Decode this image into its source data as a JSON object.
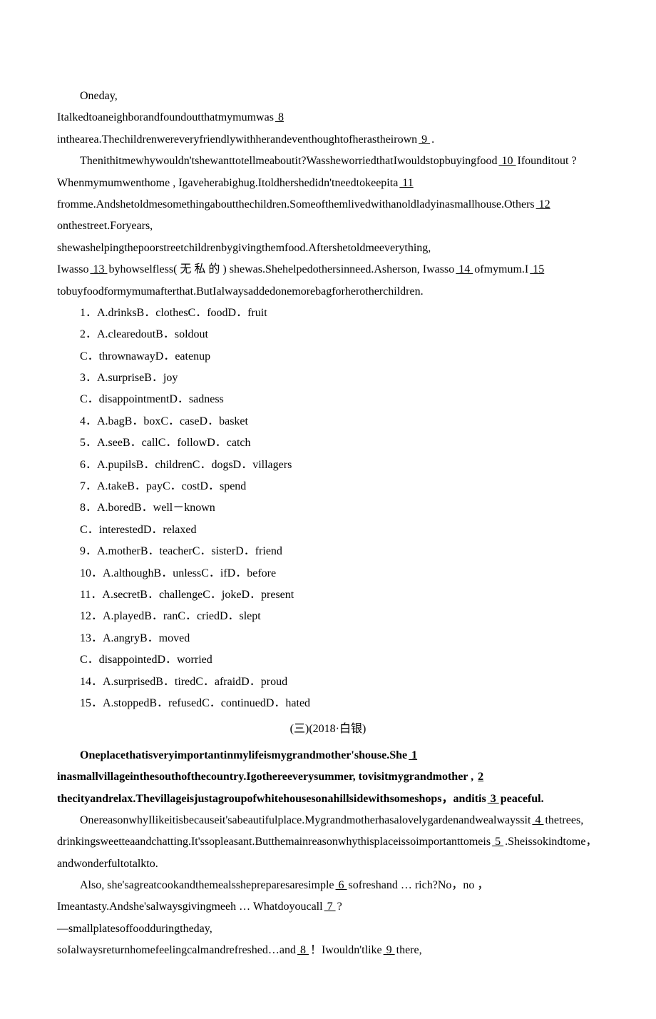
{
  "story1": {
    "p1": "Oneday,",
    "p2a": "Italkedtoaneighborandfoundoutthatmymumwas",
    "b8": "  8  ",
    "p2b": "inthearea.Thechildrenwereveryfriendlywithherandeventhoughtofherastheirown",
    "b9": "  9  ",
    "p2c": ".",
    "p3a": "Thenithitmewhywouldn'tshewanttotellmeaboutit?WassheworriedthatIwouldstopbuyingfood",
    "b10": "  10  ",
    "p3b": "Ifounditout     ?     Whenmymumwenthome   , Igaveherabighug.Itoldhershedidn'tneedtokeepita",
    "b11": "  11  ",
    "p3c": "fromme.Andshetoldmesomethingaboutthechildren.Someofthemlivedwithanoldladyinasmallhouse.Others",
    "b12": "  12  ",
    "p3d": "onthestreet.Foryears,",
    "p4": "shewashelpingthepoorstreetchildrenbygivingthemfood.Aftershetoldmeeverything,",
    "p5a": "Iwasso",
    "b13": "  13  ",
    "p5b": "byhowselfless( 无 私 的 )  shewas.Shehelpedothersinneed.Asherson, Iwasso",
    "b14": "  14  ",
    "p5c": "ofmymum.I",
    "b15": "  15  ",
    "p5d": "tobuyfoodformymumafterthat.ButIalwaysaddedonemorebagforherotherchildren."
  },
  "questions1": [
    "1．A.drinksB．clothesC．foodD．fruit",
    "2．A.clearedoutB．soldout",
    "C．thrownawayD．eatenup",
    "3．A.surpriseB．joy",
    "C．disappointmentD．sadness",
    "4．A.bagB．boxC．caseD．basket",
    "5．A.seeB．callC．followD．catch",
    "6．A.pupilsB．childrenC．dogsD．villagers",
    "7．A.takeB．payC．costD．spend",
    "8．A.boredB．well－known",
    "C．interestedD．relaxed",
    "9．A.motherB．teacherC．sisterD．friend",
    "10．A.althoughB．unlessC．ifD．before",
    "11．A.secretB．challengeC．jokeD．present",
    "12．A.playedB．ranC．criedD．slept",
    "13．A.angryB．moved",
    "C．disappointedD．worried",
    "14．A.surprisedB．tiredC．afraidD．proud",
    "15．A.stoppedB．refusedC．continuedD．hated"
  ],
  "section_title": "(三)(2018·白银)",
  "story2": {
    "p1a": "Oneplacethatisveryimportantinmylifeismygrandmother'shouse.She",
    "b1": "  1  ",
    "p1b": "inasmallvillageinthesouthofthecountry.Igothereeverysummer,    tovisitmygrandmother   ,",
    "b2": "  2  ",
    "p1c": "thecityandrelax.Thevillageisjustagroupofwhitehousesonahillsidewithsomeshops，anditis",
    "b3": "  3  ",
    "p1d": "peaceful.",
    "p2a": "OnereasonwhyIlikeitisbecauseit'sabeautifulplace.Mygrandmotherhasalovelygardenandwealwayssit",
    "b4": "  4  ",
    "p2b": "thetrees,",
    "p3a": "drinkingsweetteaandchatting.It'ssopleasant.Butthemainreasonwhythisplaceissoimportanttomeis",
    "b5": "  5  ",
    "p3b": ".Sheissokindtome，andwonderfultotalkto.",
    "p4a": "Also,   she'sagreatcookandthemealsshepreparesaresimple",
    "b6": "  6  ",
    "p4b": "sofreshand  … rich?No，no ， Imeantasty.Andshe'salwaysgivingmeeh … Whatdoyoucall",
    "b7": "  7  ",
    "p4c": " ?",
    "p5a": "—smallplatesoffoodduringtheday,",
    "p6a": "soIalwaysreturnhomefeelingcalmandrefreshed…and",
    "b8": "  8  ",
    "p6b": "！Iwouldn'tlike",
    "b9": "  9  ",
    "p6c": "there,"
  }
}
